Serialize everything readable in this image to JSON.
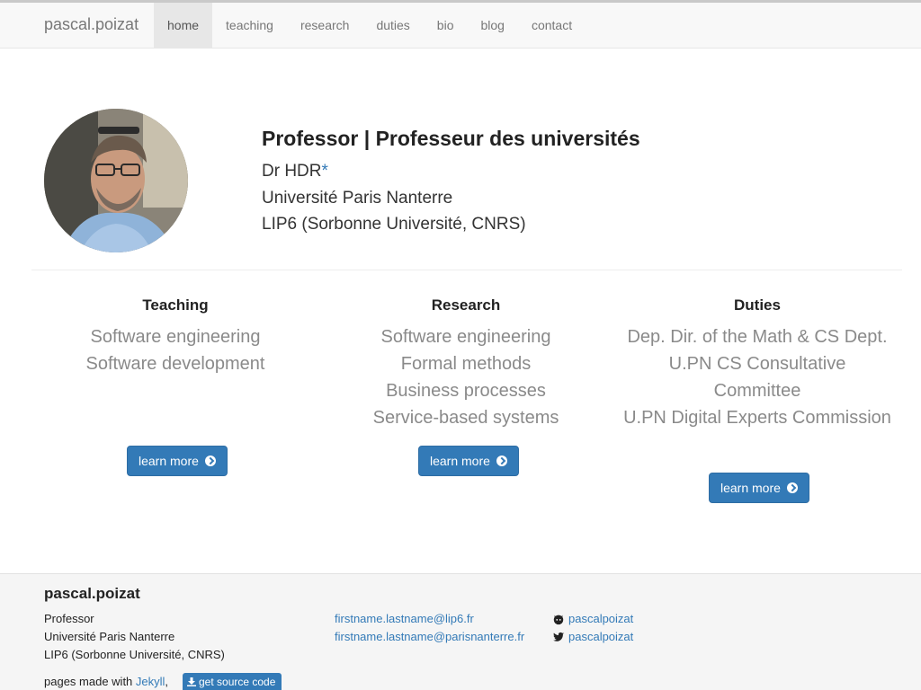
{
  "navbar": {
    "brand": "pascal.poizat",
    "items": [
      {
        "label": "home",
        "active": true
      },
      {
        "label": "teaching"
      },
      {
        "label": "research"
      },
      {
        "label": "duties"
      },
      {
        "label": "bio"
      },
      {
        "label": "blog"
      },
      {
        "label": "contact"
      }
    ]
  },
  "hero": {
    "title": "Professor | Professeur des universités",
    "line1": "Dr HDR",
    "line1_star": "*",
    "line2": "Université Paris Nanterre",
    "line3": "LIP6 (Sorbonne Université, CNRS)"
  },
  "columns": [
    {
      "heading": "Teaching",
      "items": [
        "Software engineering",
        "Software development"
      ],
      "button": "learn more"
    },
    {
      "heading": "Research",
      "items": [
        "Software engineering",
        "Formal methods",
        "Business processes",
        "Service-based systems"
      ],
      "button": "learn more"
    },
    {
      "heading": "Duties",
      "items": [
        "Dep. Dir. of the Math & CS Dept.",
        "U.PN CS Consultative",
        "Committee",
        "U.PN Digital Experts Commission"
      ],
      "button": "learn more"
    }
  ],
  "footer": {
    "title": "pascal.poizat",
    "lines": [
      "Professor",
      "Université Paris Nanterre",
      "LIP6 (Sorbonne Université, CNRS)"
    ],
    "emails": [
      "firstname.lastname@lip6.fr",
      "firstname.lastname@parisnanterre.fr"
    ],
    "github": "pascalpoizat",
    "twitter": "pascalpoizat",
    "made_prefix": "pages made with ",
    "made_link": "Jekyll",
    "made_suffix": ",",
    "source_button": "get source code"
  },
  "colors": {
    "accent": "#337ab7",
    "navbar_bg": "#f8f8f8",
    "footer_bg": "#f5f5f5"
  },
  "icons": [
    "github-icon",
    "twitter-icon",
    "download-icon",
    "chevron-circle-right-icon"
  ]
}
